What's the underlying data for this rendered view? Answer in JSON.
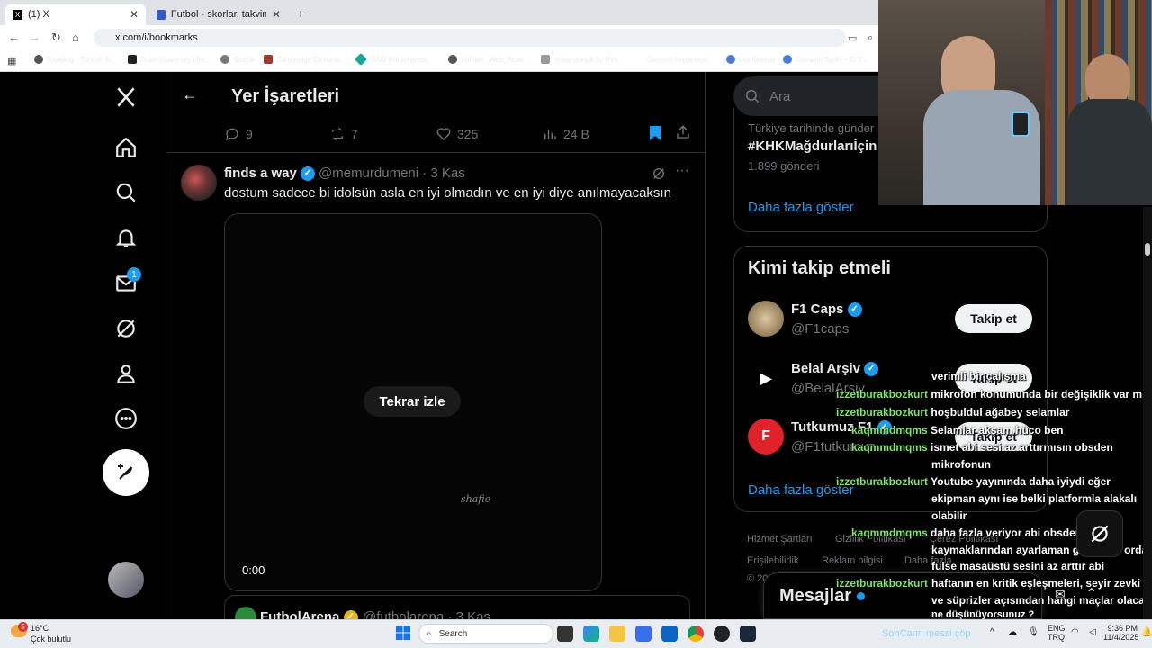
{
  "browser": {
    "tabs": [
      {
        "label": "(1) X",
        "active": true
      },
      {
        "label": "Futbol - skorlar, takvim & oran",
        "active": false
      }
    ],
    "url": "x.com/i/bookmarks",
    "bookmarks": [
      "Reading - Turkish A...",
      "Duke University Libr...",
      "Sözlük",
      "Cambridge Dictiona...",
      "İSAM Kütüphanes...",
      "Apikam_Web_Arsiv...",
      "İmparatorluk by Rys...",
      "Osmanlı İmparatorl...",
      "LexiQamus",
      "Osmanlı Tarihi – El Y..."
    ]
  },
  "nav": {
    "messages_badge": "1"
  },
  "header": {
    "title": "Yer İşaretleri"
  },
  "prev_tweet_metrics": {
    "replies": "9",
    "reposts": "7",
    "likes": "325",
    "views": "24 B"
  },
  "tweet": {
    "name": "finds a way",
    "handle": "@memurdumeni · 3 Kas",
    "text": "dostum sadece bi idolsün asla en iyi olmadın ve en iyi diye anılmayacaksın",
    "replay_label": "Tekrar izle",
    "time": "0:00",
    "watermark": "shafie"
  },
  "next_tweet": {
    "name": "FutbolArena",
    "handle": "@futbolarena · 3 Kas"
  },
  "sidebar": {
    "search_placeholder": "Ara",
    "trend": {
      "context": "Türkiye tarihinde günder",
      "tag": "#KHKMağdurlarıİçin",
      "count": "1.899 gönderi"
    },
    "show_more": "Daha fazla göster",
    "who_title": "Kimi takip etmeli",
    "suggestions": [
      {
        "name": "F1 Caps",
        "handle": "@F1caps"
      },
      {
        "name": "Belal Arşiv",
        "handle": "@BelalArsiv"
      },
      {
        "name": "Tutkumuz F1",
        "handle": "@F1tutkumuz"
      }
    ],
    "follow_label": "Takip et",
    "show_more_2": "Daha fazla göster",
    "footer": [
      "Hizmet Şartları",
      "Gizlilik Politikası",
      "Çerez Politikası",
      "Erişilebilirlik",
      "Reklam bilgisi",
      "Daha fazla ...",
      "© 2025 X Corp."
    ],
    "messages_title": "Mesajlar"
  },
  "chat": [
    {
      "user": "",
      "text": "verimli bir çalışma"
    },
    {
      "user": "izzetburakbozkurt",
      "text": "mikrofon konumunda bir değişiklik var mı"
    },
    {
      "user": "izzetburakbozkurt",
      "text": "hoşbuldul ağabey selamlar"
    },
    {
      "user": "kaqmmdmqms",
      "text": "Selamlar akşam hüco ben"
    },
    {
      "user": "kaqmmdmqms",
      "text": "ismet abi sesi az arttırmısın obsden"
    },
    {
      "user": "",
      "text": "mikrofonun"
    },
    {
      "user": "izzetburakbozkurt",
      "text": "Youtube yayınında daha iyiydi eğer"
    },
    {
      "user": "",
      "text": "ekipman aynı ise belki platformla alakalı"
    },
    {
      "user": "",
      "text": "olabilir"
    },
    {
      "user": "kaqmmdmqms",
      "text": "daha fazla veriyor abi obsden ses"
    },
    {
      "user": "",
      "text": "kaymaklarından ayarlaman gerekiyor orda"
    },
    {
      "user": "",
      "text": "fulse masaüstü sesini az arttır abi"
    },
    {
      "user": "",
      "text": "haftanın en kritik eşleşmeleri, seyir zevki"
    },
    {
      "user": "izzetburakbozkurt",
      "text": "ve süprizler açısından hangi maçlar olacak"
    },
    {
      "user": "",
      "text": "ne düşünüyorsunuz ?"
    }
  ],
  "taskbar": {
    "weather_temp": "16°C",
    "weather_desc": "Çok bulutlu",
    "weather_badge": "5",
    "search": "Search",
    "lang1": "ENG",
    "lang2": "TRQ",
    "time": "9:36 PM",
    "date": "11/4/2025",
    "overlay_text": "SonCann  messi çöp"
  }
}
